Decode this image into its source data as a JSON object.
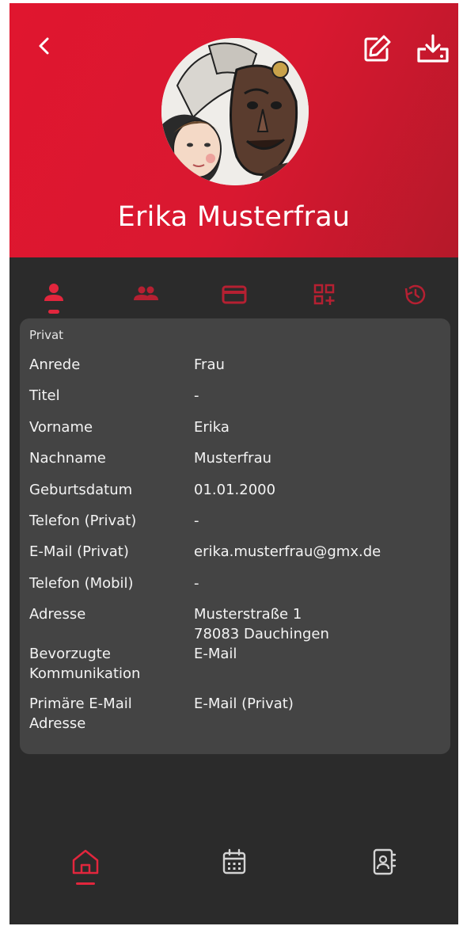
{
  "header": {
    "name": "Erika Musterfrau",
    "color": "#e0162f"
  },
  "tabs": [
    {
      "icon": "person-icon",
      "active": true
    },
    {
      "icon": "group-icon",
      "active": false
    },
    {
      "icon": "credit-card-icon",
      "active": false
    },
    {
      "icon": "qr-add-icon",
      "active": false
    },
    {
      "icon": "history-icon",
      "active": false
    }
  ],
  "details": {
    "section": "Privat",
    "rows": [
      {
        "label": "Anrede",
        "value": "Frau"
      },
      {
        "label": "Titel",
        "value": "-"
      },
      {
        "label": "Vorname",
        "value": "Erika"
      },
      {
        "label": "Nachname",
        "value": "Musterfrau"
      },
      {
        "label": "Geburtsdatum",
        "value": "01.01.2000"
      },
      {
        "label": "Telefon (Privat)",
        "value": "-"
      },
      {
        "label": "E-Mail (Privat)",
        "value": "erika.musterfrau@gmx.de"
      },
      {
        "label": "Telefon (Mobil)",
        "value": "-"
      },
      {
        "label": "Adresse",
        "value": "Musterstraße 1\n78083 Dauchingen"
      },
      {
        "label": "Bevorzugte\nKommunikation",
        "value": "E-Mail"
      },
      {
        "label": "Primäre E-Mail\nAdresse",
        "value": "E-Mail (Privat)"
      }
    ]
  },
  "bottom_nav": [
    {
      "icon": "home-icon",
      "active": true
    },
    {
      "icon": "calendar-icon",
      "active": false
    },
    {
      "icon": "contacts-icon",
      "active": false
    }
  ],
  "colors": {
    "accent": "#e2263d",
    "background": "#2b2b2b",
    "card": "#444444"
  }
}
